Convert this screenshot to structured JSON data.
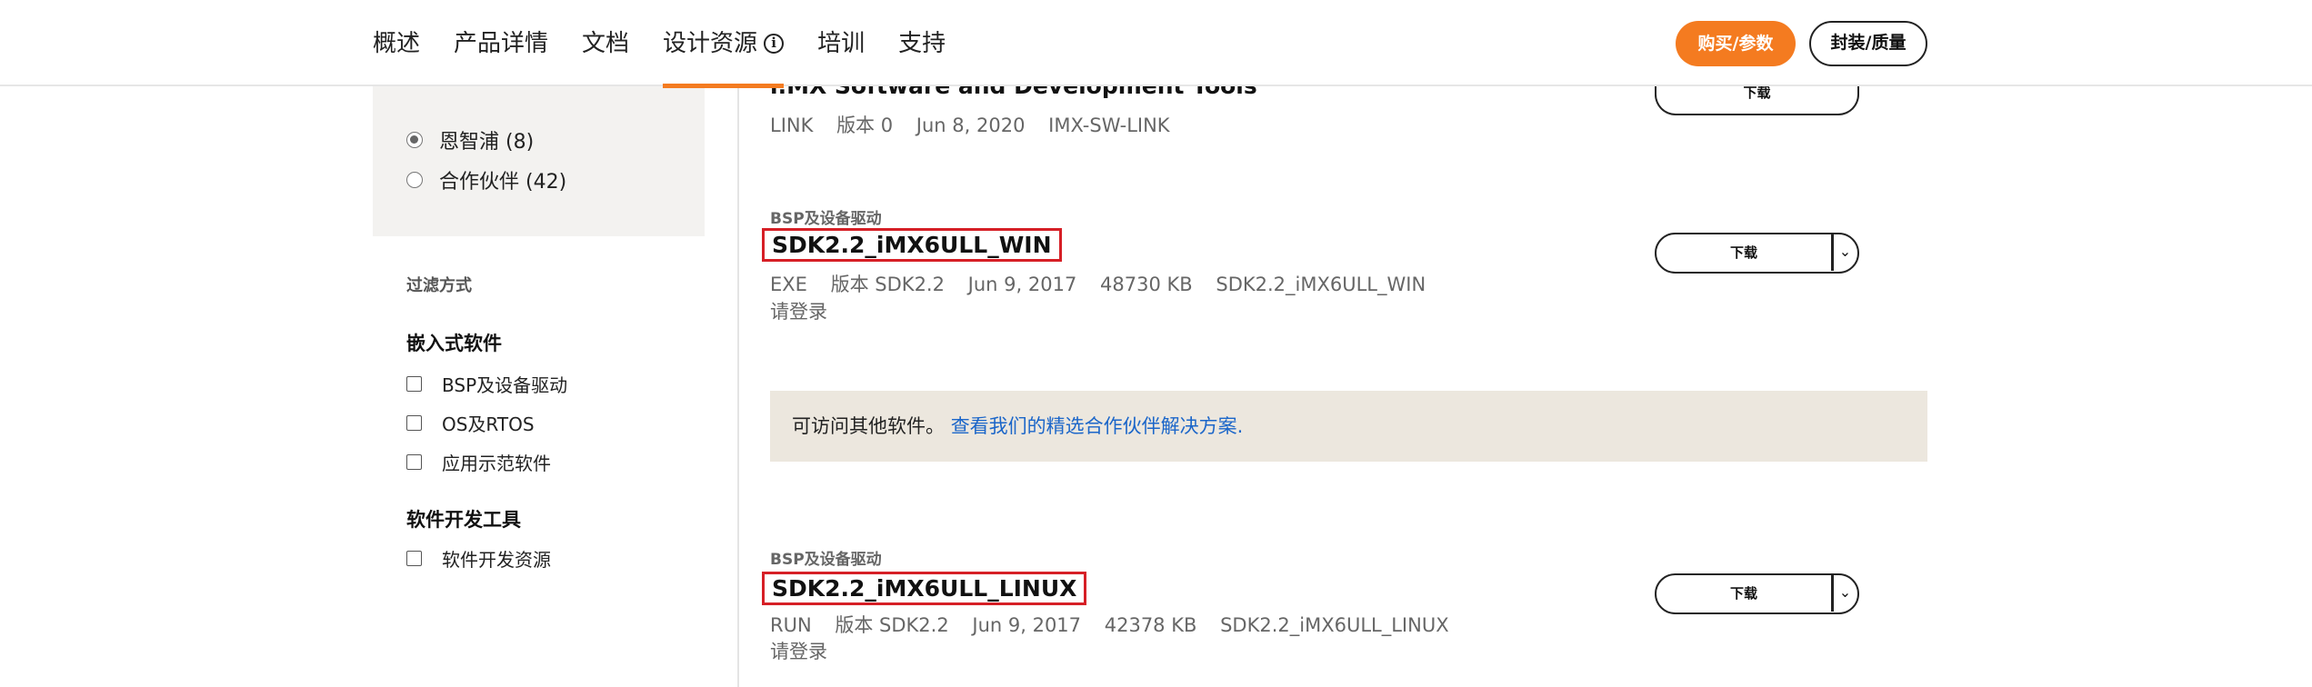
{
  "nav": {
    "items": [
      {
        "label": "概述"
      },
      {
        "label": "产品详情"
      },
      {
        "label": "文档"
      },
      {
        "label": "设计资源"
      },
      {
        "label": "培训"
      },
      {
        "label": "支持"
      }
    ],
    "active_index": 3,
    "info_icon": "ⓘ",
    "buy_label": "购买/参数",
    "package_label": "封装/质量",
    "accent_color": "#f47b20"
  },
  "sidebar": {
    "sources": [
      {
        "label": "恩智浦 (8)",
        "checked": true
      },
      {
        "label": "合作伙伴 (42)",
        "checked": false
      }
    ],
    "filter_title": "过滤方式",
    "groups": [
      {
        "title": "嵌入式软件",
        "items": [
          "BSP及设备驱动",
          "OS及RTOS",
          "应用示范软件"
        ]
      },
      {
        "title": "软件开发工具",
        "items": [
          "软件开发资源"
        ]
      }
    ]
  },
  "results": {
    "partial": {
      "title": "i.MX Software and Development Tools",
      "meta": [
        "LINK",
        "版本 0",
        "Jun 8, 2020",
        "IMX-SW-LINK"
      ],
      "download_label": "下载"
    },
    "items": [
      {
        "category": "BSP及设备驱动",
        "title": "SDK2.2_iMX6ULL_WIN",
        "meta": [
          "EXE",
          "版本 SDK2.2",
          "Jun 9, 2017",
          "48730 KB",
          "SDK2.2_iMX6ULL_WIN"
        ],
        "login": "请登录",
        "download_label": "下载"
      },
      {
        "category": "BSP及设备驱动",
        "title": "SDK2.2_iMX6ULL_LINUX",
        "meta": [
          "RUN",
          "版本 SDK2.2",
          "Jun 9, 2017",
          "42378 KB",
          "SDK2.2_iMX6ULL_LINUX"
        ],
        "login": "请登录",
        "download_label": "下载"
      }
    ],
    "notice": {
      "text": "可访问其他软件。",
      "link": "查看我们的精选合作伙伴解决方案."
    },
    "highlight_color": "#d61f26"
  }
}
